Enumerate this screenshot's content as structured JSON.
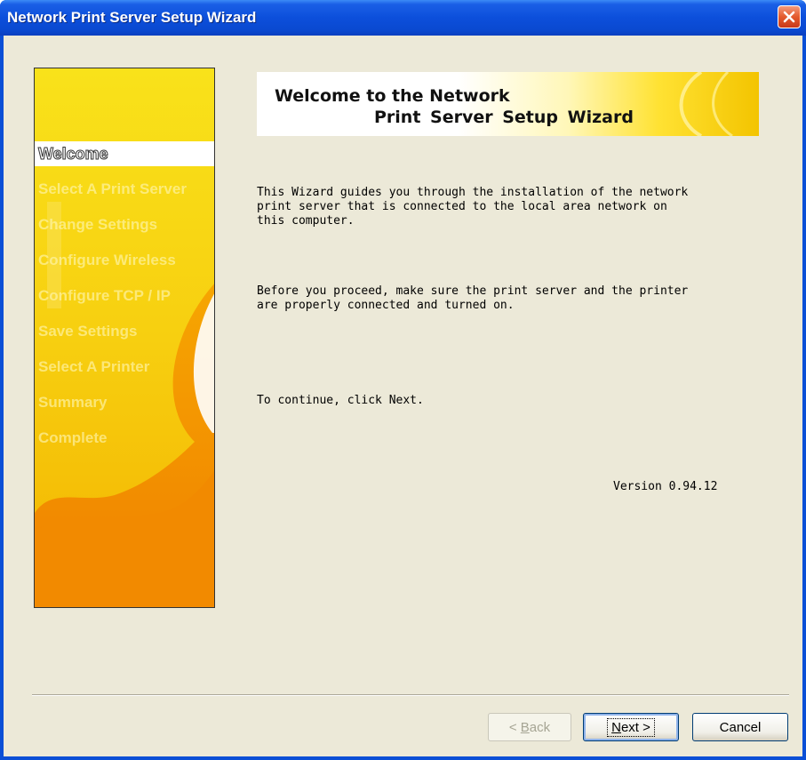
{
  "window": {
    "title": "Network Print Server Setup Wizard",
    "close_icon": "close-icon"
  },
  "steps": [
    {
      "label": "Welcome",
      "active": true
    },
    {
      "label": "Select A Print Server",
      "active": false
    },
    {
      "label": "Change Settings",
      "active": false
    },
    {
      "label": "Configure Wireless",
      "active": false
    },
    {
      "label": "Configure  TCP / IP",
      "active": false
    },
    {
      "label": "Save Settings",
      "active": false
    },
    {
      "label": "Select  A  Printer",
      "active": false
    },
    {
      "label": "Summary",
      "active": false
    },
    {
      "label": "Complete",
      "active": false
    }
  ],
  "banner": {
    "line1": "Welcome to the Network",
    "line2": "Print  Server  Setup Wizard"
  },
  "body": {
    "para1_line1": "This Wizard guides you through the installation of the network",
    "para1_line2": "print server that is connected to the local area network on",
    "para1_line3": "this computer.",
    "para2_line1": "Before you proceed, make sure the print server and the printer",
    "para2_line2": "are properly connected and turned on.",
    "para3": "To continue, click Next.",
    "version": "Version 0.94.12"
  },
  "buttons": {
    "back_prefix": "< ",
    "back_mnemonic": "B",
    "back_rest": "ack",
    "next_mnemonic": "N",
    "next_rest": "ext >",
    "cancel": "Cancel"
  },
  "colors": {
    "titlebar": "#0a49d0",
    "panel_yellow": "#f7d718",
    "panel_orange": "#f29000",
    "dialog_bg": "#ece9d8"
  }
}
